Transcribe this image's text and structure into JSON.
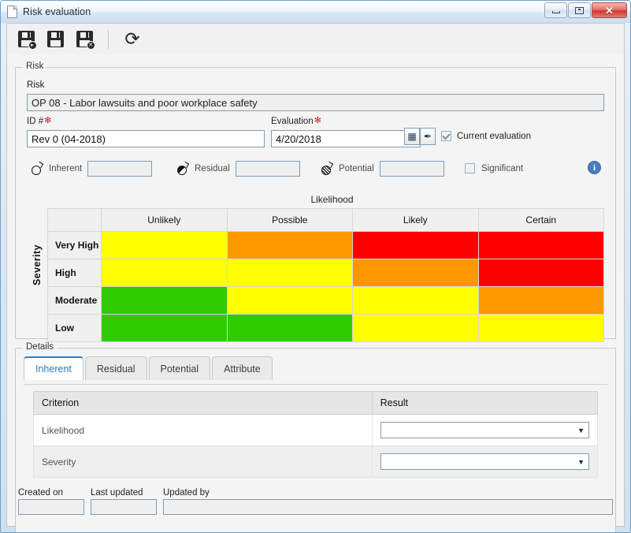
{
  "window": {
    "title": "Risk evaluation",
    "doc_icon": "document-icon",
    "minimize_label": "",
    "restore_label": "",
    "close_label": "✕"
  },
  "toolbar": {
    "save_and_new_tip": "Save and new",
    "save_tip": "Save",
    "save_and_close_tip": "Save and close",
    "refresh_tip": "Refresh",
    "refresh_glyph": "⟳",
    "badge_new": "▸",
    "badge_close": "✕"
  },
  "risk_group": {
    "legend": "Risk",
    "risk_label": "Risk",
    "risk_value": "OP 08 - Labor lawsuits and poor workplace safety",
    "id_label": "ID #",
    "id_value": "Rev 0 (04-2018)",
    "evaluation_label": "Evaluation",
    "evaluation_value": "4/20/2018",
    "required_marker": "✻",
    "calendar_icon": "Ὄ5",
    "calendar_glyph": "▦",
    "clear_glyph": "✒",
    "current_evaluation_label": "Current evaluation",
    "current_evaluation_checked": true
  },
  "scores": {
    "inherent_label": "Inherent",
    "inherent_value": "",
    "residual_label": "Residual",
    "residual_value": "",
    "potential_label": "Potential",
    "potential_value": "",
    "significant_label": "Significant",
    "significant_checked": false,
    "info_glyph": "i"
  },
  "matrix": {
    "x_axis_title": "Likelihood",
    "y_axis_title": "Severity",
    "columns": [
      "Unlikely",
      "Possible",
      "Likely",
      "Certain"
    ],
    "rows": [
      "Very High",
      "High",
      "Moderate",
      "Low"
    ],
    "colors": {
      "green": "#2ecc00",
      "yellow": "#ffff00",
      "orange": "#ff9800",
      "red": "#fe0000"
    },
    "cells": [
      [
        "yellow",
        "orange",
        "red",
        "red"
      ],
      [
        "yellow",
        "yellow",
        "orange",
        "red"
      ],
      [
        "green",
        "yellow",
        "yellow",
        "orange"
      ],
      [
        "green",
        "green",
        "yellow",
        "yellow"
      ]
    ]
  },
  "details": {
    "legend": "Details",
    "tabs": [
      {
        "label": "Inherent",
        "active": true
      },
      {
        "label": "Residual",
        "active": false
      },
      {
        "label": "Potential",
        "active": false
      },
      {
        "label": "Attribute",
        "active": false
      }
    ],
    "table": {
      "headers": [
        "Criterion",
        "Result"
      ],
      "rows": [
        {
          "criterion": "Likelihood",
          "result": "",
          "dropdown": true
        },
        {
          "criterion": "Severity",
          "result": "",
          "dropdown": true
        }
      ]
    },
    "dropdown_arrow": "▼"
  },
  "footer": {
    "created_on_label": "Created on",
    "created_on_value": "",
    "last_updated_label": "Last updated",
    "last_updated_value": "",
    "updated_by_label": "Updated by",
    "updated_by_value": ""
  }
}
